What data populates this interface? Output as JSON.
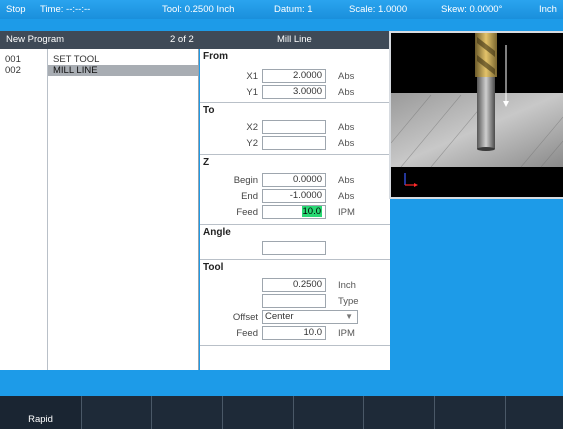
{
  "status_bar": {
    "state": "Stop",
    "time": "Time: --:--:--",
    "tool": "Tool: 0.2500 Inch",
    "datum": "Datum: 1",
    "scale": "Scale: 1.0000",
    "skew": "Skew: 0.0000°",
    "units": "Inch"
  },
  "program_header": {
    "title": "New Program",
    "position": "2 of 2",
    "step_name": "Mill Line"
  },
  "program_steps": [
    {
      "num": "001",
      "name": "SET TOOL",
      "selected": false
    },
    {
      "num": "002",
      "name": "MILL LINE",
      "selected": true
    }
  ],
  "form": {
    "from": {
      "title": "From",
      "x1": {
        "label": "X1",
        "value": "2.0000",
        "unit": "Abs"
      },
      "y1": {
        "label": "Y1",
        "value": "3.0000",
        "unit": "Abs"
      }
    },
    "to": {
      "title": "To",
      "x2": {
        "label": "X2",
        "value": "",
        "unit": "Abs"
      },
      "y2": {
        "label": "Y2",
        "value": "",
        "unit": "Abs"
      }
    },
    "z": {
      "title": "Z",
      "begin": {
        "label": "Begin",
        "value": "0.0000",
        "unit": "Abs"
      },
      "end": {
        "label": "End",
        "value": "-1.0000",
        "unit": "Abs"
      },
      "feed": {
        "label": "Feed",
        "value": "10.0",
        "unit": "IPM"
      }
    },
    "angle": {
      "title": "Angle",
      "value": ""
    },
    "tool": {
      "title": "Tool",
      "diameter": {
        "value": "0.2500",
        "unit": "Inch"
      },
      "type": {
        "value": "",
        "unit": "Type"
      },
      "offset": {
        "label": "Offset",
        "value": "Center"
      },
      "feed": {
        "label": "Feed",
        "value": "10.0",
        "unit": "IPM"
      }
    }
  },
  "softkeys": [
    {
      "label": "Rapid"
    },
    {
      "label": ""
    },
    {
      "label": ""
    },
    {
      "label": ""
    },
    {
      "label": ""
    },
    {
      "label": ""
    },
    {
      "label": ""
    },
    {
      "label": ""
    }
  ],
  "colors": {
    "accent_blue": "#1d9be8",
    "header_dark": "#3f4a57",
    "softkey_bg": "#1e2a38",
    "active_field": "#28d873"
  }
}
